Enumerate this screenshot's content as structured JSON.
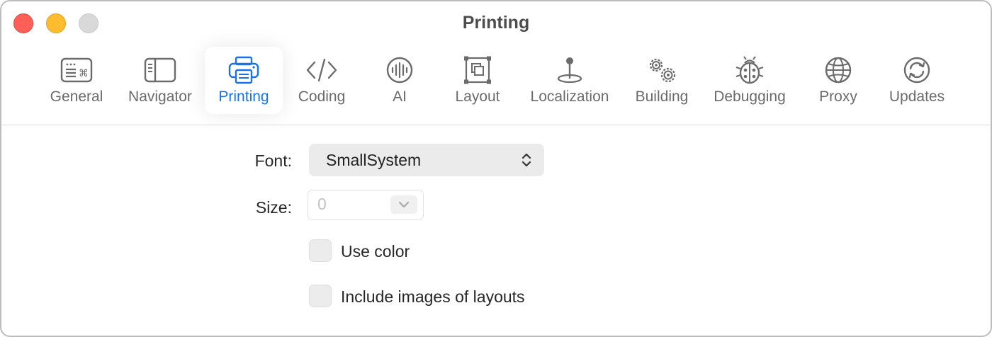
{
  "window": {
    "title": "Printing"
  },
  "toolbar": {
    "items": [
      {
        "label": "General",
        "icon": "keyboard-icon"
      },
      {
        "label": "Navigator",
        "icon": "sidebar-icon"
      },
      {
        "label": "Printing",
        "icon": "printer-icon",
        "selected": true
      },
      {
        "label": "Coding",
        "icon": "code-brackets-icon"
      },
      {
        "label": "AI",
        "icon": "waveform-icon"
      },
      {
        "label": "Layout",
        "icon": "layout-frame-icon"
      },
      {
        "label": "Localization",
        "icon": "pin-icon"
      },
      {
        "label": "Building",
        "icon": "gears-icon"
      },
      {
        "label": "Debugging",
        "icon": "ladybug-icon"
      },
      {
        "label": "Proxy",
        "icon": "globe-icon"
      },
      {
        "label": "Updates",
        "icon": "refresh-icon"
      }
    ]
  },
  "form": {
    "font_label": "Font:",
    "font_value": "SmallSystem",
    "size_label": "Size:",
    "size_value": "0",
    "use_color_label": "Use color",
    "use_color_checked": false,
    "include_images_label": "Include images of layouts",
    "include_images_checked": false
  },
  "colors": {
    "accent": "#1a73e8",
    "close": "#fe5f57",
    "minimize": "#febc2e",
    "zoom": "#d9d9d9"
  }
}
